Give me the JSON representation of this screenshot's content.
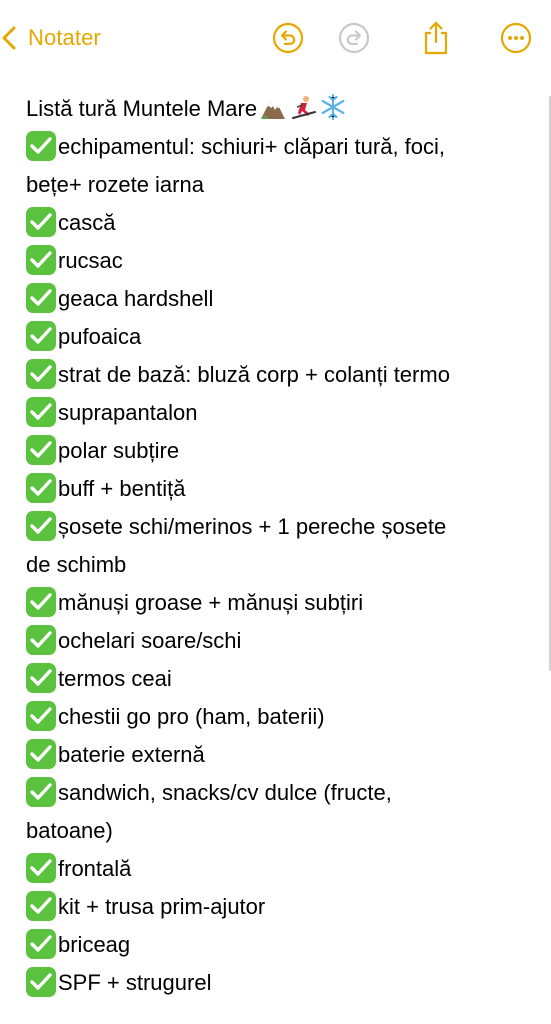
{
  "toolbar": {
    "back_label": "Notater",
    "icons": [
      "undo-icon",
      "redo-icon",
      "share-icon",
      "more-icon"
    ],
    "accent_color": "#E5A800"
  },
  "note": {
    "title": "Listă tură Muntele Mare",
    "title_emojis": [
      "mountain-emoji",
      "skier-emoji",
      "snowflake-emoji"
    ],
    "items": [
      {
        "text": "echipamentul: schiuri+ clăpari tură, foci,",
        "checked": true
      },
      {
        "text": "bețe+ rozete iarna",
        "checked": false
      },
      {
        "text": "cască",
        "checked": true
      },
      {
        "text": "rucsac",
        "checked": true
      },
      {
        "text": "geaca hardshell",
        "checked": true
      },
      {
        "text": "pufoaica",
        "checked": true
      },
      {
        "text": "strat de bază: bluză corp + colanți termo",
        "checked": true
      },
      {
        "text": "suprapantalon",
        "checked": true
      },
      {
        "text": "polar subțire",
        "checked": true
      },
      {
        "text": "buff + bentiță",
        "checked": true
      },
      {
        "text": "șosete schi/merinos + 1 pereche șosete",
        "checked": true
      },
      {
        "text": "de schimb",
        "checked": false
      },
      {
        "text": "mănuși groase + mănuși subțiri",
        "checked": true
      },
      {
        "text": "ochelari soare/schi",
        "checked": true
      },
      {
        "text": "termos ceai",
        "checked": true
      },
      {
        "text": "chestii go pro (ham, baterii)",
        "checked": true
      },
      {
        "text": "baterie externă",
        "checked": true
      },
      {
        "text": "sandwich, snacks/cv dulce (fructe,",
        "checked": true
      },
      {
        "text": "batoane)",
        "checked": false
      },
      {
        "text": "frontală",
        "checked": true
      },
      {
        "text": "kit + trusa prim-ajutor",
        "checked": true
      },
      {
        "text": "briceag",
        "checked": true
      },
      {
        "text": "SPF + strugurel",
        "checked": true
      }
    ],
    "check_color": "#5AC23E"
  }
}
